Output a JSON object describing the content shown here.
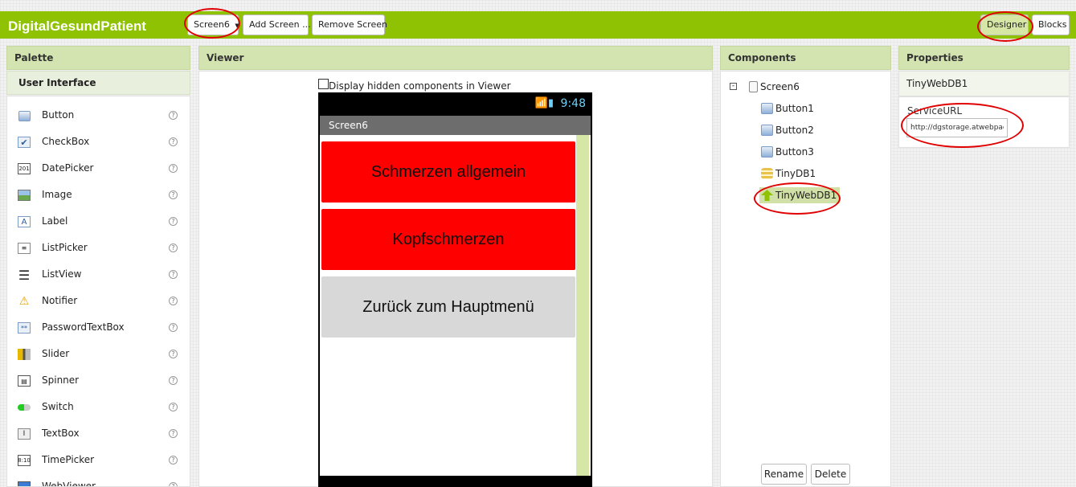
{
  "app": {
    "title": "DigitalGesundPatient"
  },
  "toolbar": {
    "screen_select": "Screen6",
    "add_screen": "Add Screen ...",
    "remove_screen": "Remove Screen",
    "designer": "Designer",
    "blocks": "Blocks"
  },
  "palette": {
    "header": "Palette",
    "section": "User Interface",
    "items": [
      {
        "label": "Button",
        "icon": "button-icon"
      },
      {
        "label": "CheckBox",
        "icon": "checkbox-icon"
      },
      {
        "label": "DatePicker",
        "icon": "datepicker-icon"
      },
      {
        "label": "Image",
        "icon": "image-icon"
      },
      {
        "label": "Label",
        "icon": "label-icon"
      },
      {
        "label": "ListPicker",
        "icon": "listpicker-icon"
      },
      {
        "label": "ListView",
        "icon": "listview-icon"
      },
      {
        "label": "Notifier",
        "icon": "notifier-icon"
      },
      {
        "label": "PasswordTextBox",
        "icon": "password-icon"
      },
      {
        "label": "Slider",
        "icon": "slider-icon"
      },
      {
        "label": "Spinner",
        "icon": "spinner-icon"
      },
      {
        "label": "Switch",
        "icon": "switch-icon"
      },
      {
        "label": "TextBox",
        "icon": "textbox-icon"
      },
      {
        "label": "TimePicker",
        "icon": "timepicker-icon"
      },
      {
        "label": "WebViewer",
        "icon": "webviewer-icon"
      }
    ],
    "help_glyph": "?"
  },
  "viewer": {
    "header": "Viewer",
    "display_hidden_label": "Display hidden components in Viewer",
    "phone": {
      "time": "9:48",
      "screen_title": "Screen6",
      "buttons": [
        {
          "text": "Schmerzen allgemein",
          "color": "#ff0000"
        },
        {
          "text": "Kopfschmerzen",
          "color": "#ff0000"
        },
        {
          "text": "Zurück zum Hauptmenü",
          "color": "#d8d8d8"
        }
      ]
    }
  },
  "components": {
    "header": "Components",
    "root": "Screen6",
    "children": [
      "Button1",
      "Button2",
      "Button3",
      "TinyDB1",
      "TinyWebDB1"
    ],
    "selected": "TinyWebDB1",
    "rename": "Rename",
    "delete": "Delete"
  },
  "properties": {
    "header": "Properties",
    "component": "TinyWebDB1",
    "service_url_label": "ServiceURL",
    "service_url_value": "http://dgstorage.atwebpages.com"
  },
  "colors": {
    "toolbar": "#8fc202",
    "panel_header": "#d3e4b0",
    "annotation": "#e00000"
  }
}
